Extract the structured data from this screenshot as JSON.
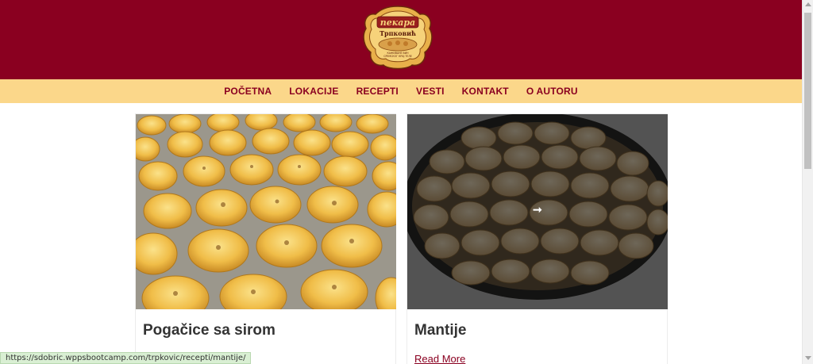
{
  "site": {
    "logo_lines": [
      "пекара",
      "Трпковић",
      "КАЖИВАНЕ ВИН",
      "СРЕМСКОГ КРАЈ ТЕЛЕ"
    ]
  },
  "nav": {
    "items": [
      {
        "label": "POČETNA"
      },
      {
        "label": "LOKACIJE"
      },
      {
        "label": "RECEPTI"
      },
      {
        "label": "VESTI"
      },
      {
        "label": "KONTAKT"
      },
      {
        "label": "O AUTORU"
      }
    ]
  },
  "posts": [
    {
      "title": "Pogačice sa sirom",
      "read_more": ""
    },
    {
      "title": "Mantije",
      "read_more": "Read More",
      "hover_icon": "arrow-right-icon"
    }
  ],
  "status_bar": {
    "url": "https://sdobric.wppsbootcamp.com/trpkovic/recepti/mantije/"
  },
  "colors": {
    "brand": "#8a0020",
    "nav_bg": "#fbd78a"
  }
}
